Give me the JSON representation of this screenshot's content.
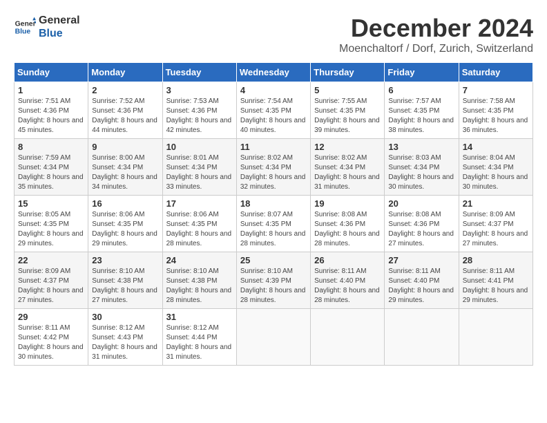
{
  "logo": {
    "general": "General",
    "blue": "Blue"
  },
  "header": {
    "month": "December 2024",
    "location": "Moenchaltorf / Dorf, Zurich, Switzerland"
  },
  "weekdays": [
    "Sunday",
    "Monday",
    "Tuesday",
    "Wednesday",
    "Thursday",
    "Friday",
    "Saturday"
  ],
  "weeks": [
    [
      {
        "day": "1",
        "sunrise": "7:51 AM",
        "sunset": "4:36 PM",
        "daylight": "8 hours and 45 minutes."
      },
      {
        "day": "2",
        "sunrise": "7:52 AM",
        "sunset": "4:36 PM",
        "daylight": "8 hours and 44 minutes."
      },
      {
        "day": "3",
        "sunrise": "7:53 AM",
        "sunset": "4:36 PM",
        "daylight": "8 hours and 42 minutes."
      },
      {
        "day": "4",
        "sunrise": "7:54 AM",
        "sunset": "4:35 PM",
        "daylight": "8 hours and 40 minutes."
      },
      {
        "day": "5",
        "sunrise": "7:55 AM",
        "sunset": "4:35 PM",
        "daylight": "8 hours and 39 minutes."
      },
      {
        "day": "6",
        "sunrise": "7:57 AM",
        "sunset": "4:35 PM",
        "daylight": "8 hours and 38 minutes."
      },
      {
        "day": "7",
        "sunrise": "7:58 AM",
        "sunset": "4:35 PM",
        "daylight": "8 hours and 36 minutes."
      }
    ],
    [
      {
        "day": "8",
        "sunrise": "7:59 AM",
        "sunset": "4:34 PM",
        "daylight": "8 hours and 35 minutes."
      },
      {
        "day": "9",
        "sunrise": "8:00 AM",
        "sunset": "4:34 PM",
        "daylight": "8 hours and 34 minutes."
      },
      {
        "day": "10",
        "sunrise": "8:01 AM",
        "sunset": "4:34 PM",
        "daylight": "8 hours and 33 minutes."
      },
      {
        "day": "11",
        "sunrise": "8:02 AM",
        "sunset": "4:34 PM",
        "daylight": "8 hours and 32 minutes."
      },
      {
        "day": "12",
        "sunrise": "8:02 AM",
        "sunset": "4:34 PM",
        "daylight": "8 hours and 31 minutes."
      },
      {
        "day": "13",
        "sunrise": "8:03 AM",
        "sunset": "4:34 PM",
        "daylight": "8 hours and 30 minutes."
      },
      {
        "day": "14",
        "sunrise": "8:04 AM",
        "sunset": "4:34 PM",
        "daylight": "8 hours and 30 minutes."
      }
    ],
    [
      {
        "day": "15",
        "sunrise": "8:05 AM",
        "sunset": "4:35 PM",
        "daylight": "8 hours and 29 minutes."
      },
      {
        "day": "16",
        "sunrise": "8:06 AM",
        "sunset": "4:35 PM",
        "daylight": "8 hours and 29 minutes."
      },
      {
        "day": "17",
        "sunrise": "8:06 AM",
        "sunset": "4:35 PM",
        "daylight": "8 hours and 28 minutes."
      },
      {
        "day": "18",
        "sunrise": "8:07 AM",
        "sunset": "4:35 PM",
        "daylight": "8 hours and 28 minutes."
      },
      {
        "day": "19",
        "sunrise": "8:08 AM",
        "sunset": "4:36 PM",
        "daylight": "8 hours and 28 minutes."
      },
      {
        "day": "20",
        "sunrise": "8:08 AM",
        "sunset": "4:36 PM",
        "daylight": "8 hours and 27 minutes."
      },
      {
        "day": "21",
        "sunrise": "8:09 AM",
        "sunset": "4:37 PM",
        "daylight": "8 hours and 27 minutes."
      }
    ],
    [
      {
        "day": "22",
        "sunrise": "8:09 AM",
        "sunset": "4:37 PM",
        "daylight": "8 hours and 27 minutes."
      },
      {
        "day": "23",
        "sunrise": "8:10 AM",
        "sunset": "4:38 PM",
        "daylight": "8 hours and 27 minutes."
      },
      {
        "day": "24",
        "sunrise": "8:10 AM",
        "sunset": "4:38 PM",
        "daylight": "8 hours and 28 minutes."
      },
      {
        "day": "25",
        "sunrise": "8:10 AM",
        "sunset": "4:39 PM",
        "daylight": "8 hours and 28 minutes."
      },
      {
        "day": "26",
        "sunrise": "8:11 AM",
        "sunset": "4:40 PM",
        "daylight": "8 hours and 28 minutes."
      },
      {
        "day": "27",
        "sunrise": "8:11 AM",
        "sunset": "4:40 PM",
        "daylight": "8 hours and 29 minutes."
      },
      {
        "day": "28",
        "sunrise": "8:11 AM",
        "sunset": "4:41 PM",
        "daylight": "8 hours and 29 minutes."
      }
    ],
    [
      {
        "day": "29",
        "sunrise": "8:11 AM",
        "sunset": "4:42 PM",
        "daylight": "8 hours and 30 minutes."
      },
      {
        "day": "30",
        "sunrise": "8:12 AM",
        "sunset": "4:43 PM",
        "daylight": "8 hours and 31 minutes."
      },
      {
        "day": "31",
        "sunrise": "8:12 AM",
        "sunset": "4:44 PM",
        "daylight": "8 hours and 31 minutes."
      },
      null,
      null,
      null,
      null
    ]
  ]
}
